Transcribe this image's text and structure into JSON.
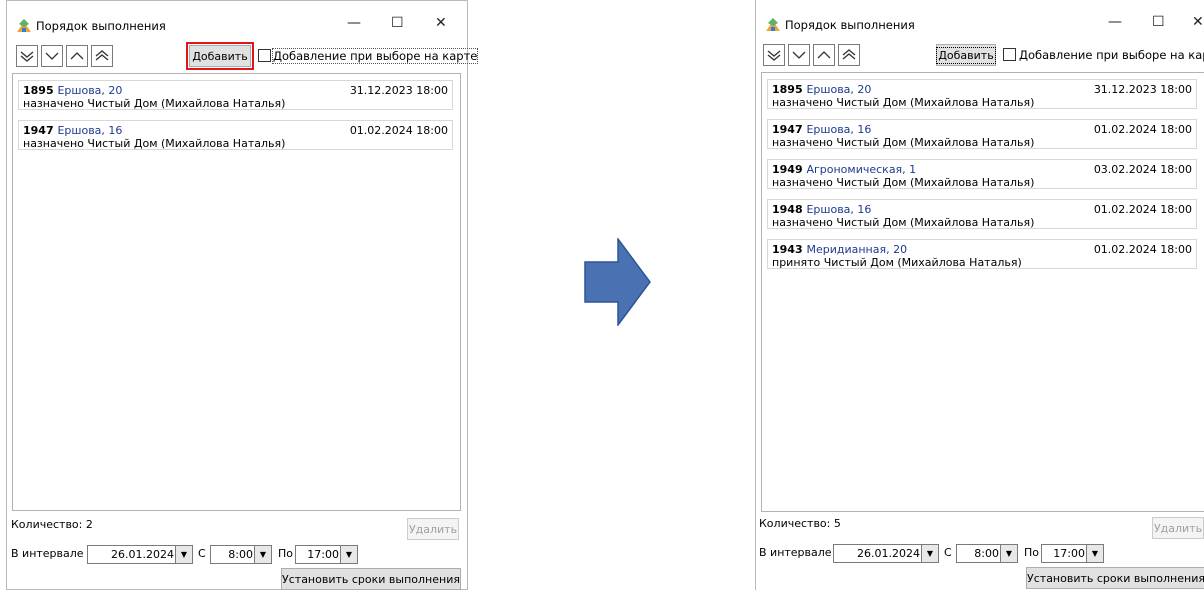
{
  "window_title": "Порядок выполнения",
  "add_button": "Добавить",
  "checkbox_label": "Добавление при выборе на карте",
  "delete_button": "Удалить",
  "interval_label": "В интервале",
  "date_value": "26.01.2024",
  "from_label": "С",
  "from_time": "8:00",
  "to_label": "По",
  "to_time": "17:00",
  "set_deadlines_button": "Установить сроки выполнения",
  "before": {
    "count_label": "Количество: 2",
    "items": [
      {
        "num": "1895",
        "address": "Ершова, 20",
        "date": "31.12.2023 18:00",
        "status": "назначено Чистый Дом (Михайлова Наталья)"
      },
      {
        "num": "1947",
        "address": "Ершова, 16",
        "date": "01.02.2024 18:00",
        "status": "назначено Чистый Дом (Михайлова Наталья)"
      }
    ]
  },
  "after": {
    "count_label": "Количество: 5",
    "items": [
      {
        "num": "1895",
        "address": "Ершова, 20",
        "date": "31.12.2023 18:00",
        "status": "назначено Чистый Дом (Михайлова Наталья)"
      },
      {
        "num": "1947",
        "address": "Ершова, 16",
        "date": "01.02.2024 18:00",
        "status": "назначено Чистый Дом (Михайлова Наталья)"
      },
      {
        "num": "1949",
        "address": "Агрономическая, 1",
        "date": "03.02.2024 18:00",
        "status": "назначено Чистый Дом (Михайлова Наталья)"
      },
      {
        "num": "1948",
        "address": "Ершова, 16",
        "date": "01.02.2024 18:00",
        "status": "назначено Чистый Дом (Михайлова Наталья)"
      },
      {
        "num": "1943",
        "address": "Меридианная, 20",
        "date": "01.02.2024 18:00",
        "status": "принято Чистый Дом (Михайлова Наталья)"
      }
    ]
  },
  "colors": {
    "highlight": "#e0161b",
    "arrow_fill": "#4a72b2",
    "link": "#1e3a8f"
  },
  "icons": [
    "app-icon",
    "minimize-icon",
    "maximize-icon",
    "close-icon",
    "double-down-icon",
    "down-icon",
    "up-icon",
    "double-up-icon",
    "dropdown-arrow-icon",
    "right-arrow-icon"
  ]
}
